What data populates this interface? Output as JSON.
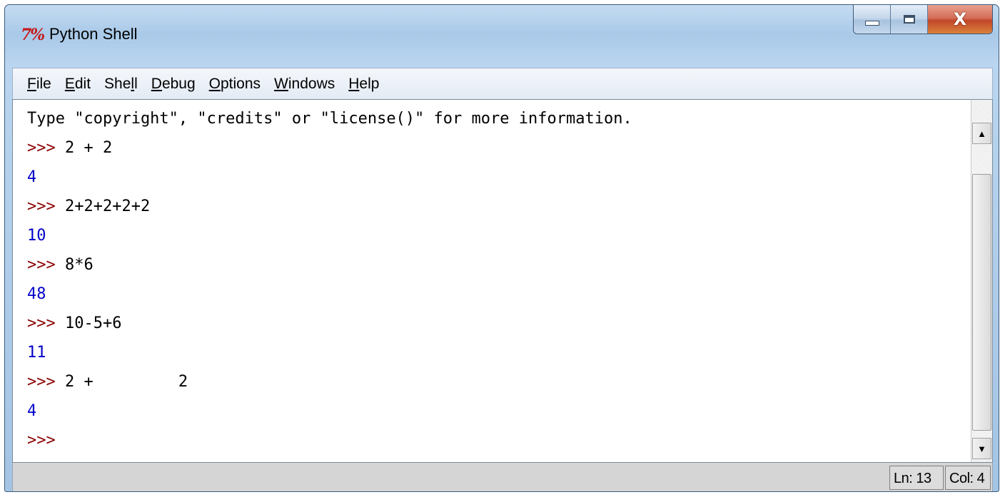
{
  "window": {
    "title": "Python Shell",
    "icon_text": "7%",
    "close_glyph": "X"
  },
  "menu": [
    {
      "label": "File",
      "accel": "F",
      "rest": "ile"
    },
    {
      "label": "Edit",
      "accel": "E",
      "rest": "dit"
    },
    {
      "label": "Shell",
      "pre": "She",
      "accel": "l",
      "rest": "l"
    },
    {
      "label": "Debug",
      "accel": "D",
      "rest": "ebug"
    },
    {
      "label": "Options",
      "accel": "O",
      "rest": "ptions"
    },
    {
      "label": "Windows",
      "accel": "W",
      "rest": "indows"
    },
    {
      "label": "Help",
      "accel": "H",
      "rest": "elp"
    }
  ],
  "shell": {
    "banner": "Type \"copyright\", \"credits\" or \"license()\" for more information.",
    "prompt": ">>>",
    "lines": [
      {
        "type": "input",
        "text": " 2 + 2"
      },
      {
        "type": "output",
        "text": "4"
      },
      {
        "type": "input",
        "text": " 2+2+2+2+2"
      },
      {
        "type": "output",
        "text": "10"
      },
      {
        "type": "input",
        "text": " 8*6"
      },
      {
        "type": "output",
        "text": "48"
      },
      {
        "type": "input",
        "text": " 10-5+6"
      },
      {
        "type": "output",
        "text": "11"
      },
      {
        "type": "input",
        "text": " 2 +         2"
      },
      {
        "type": "output",
        "text": "4"
      },
      {
        "type": "input",
        "text": ""
      }
    ]
  },
  "status": {
    "line": "Ln: 13",
    "col": "Col: 4"
  },
  "colors": {
    "prompt": "#8b0000",
    "output": "#0000c8",
    "input": "#000000"
  }
}
